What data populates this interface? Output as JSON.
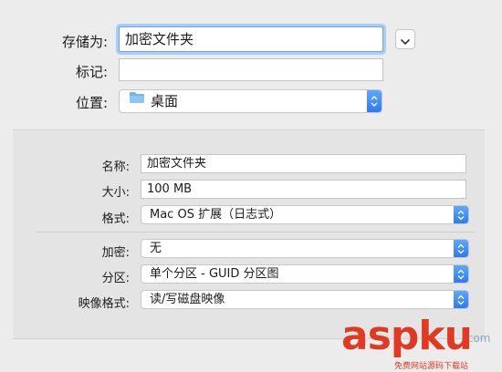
{
  "save": {
    "save_as_label": "存储为:",
    "save_as_value": "加密文件夹",
    "tags_label": "标记:",
    "tags_value": "",
    "where_label": "位置:",
    "where_value": "桌面"
  },
  "options": {
    "name_label": "名称:",
    "name_value": "加密文件夹",
    "size_label": "大小:",
    "size_value": "100 MB",
    "format_label": "格式:",
    "format_value": "Mac OS 扩展（日志式）",
    "encryption_label": "加密:",
    "encryption_value": "无",
    "partitions_label": "分区:",
    "partitions_value": "单个分区 - GUID 分区图",
    "image_format_label": "映像格式:",
    "image_format_value": "读/写磁盘映像"
  },
  "watermark": {
    "main": "aspku",
    "dotcom": ".com",
    "sub": "免费网站源码下载站"
  },
  "icons": {
    "expand": "chevron-down-icon",
    "folder": "folder-icon",
    "popup": "stepper-arrows-icon"
  },
  "colors": {
    "focus_ring": "#a9cdf6",
    "stepper_blue": "#2d7bef",
    "folder_blue": "#74b6ec",
    "watermark_red": "#e23a22"
  }
}
